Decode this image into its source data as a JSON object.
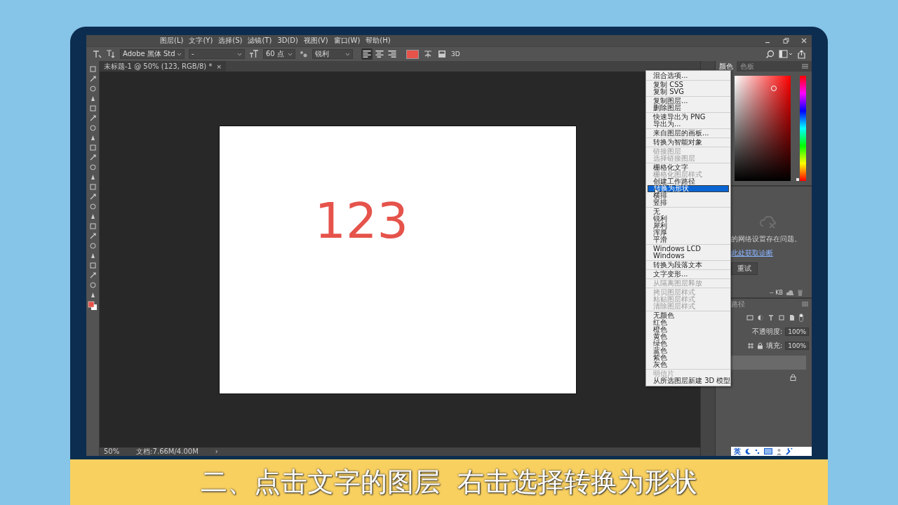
{
  "menu_bar": {
    "items": [
      "图层(L)",
      "文字(Y)",
      "选择(S)",
      "滤镜(T)",
      "3D(D)",
      "视图(V)",
      "窗口(W)",
      "帮助(H)"
    ]
  },
  "options_bar": {
    "font_family": "Adobe 黑体 Std",
    "font_style": "-",
    "size": "60 点",
    "antialias": "锐利",
    "mode_3d": "3D",
    "alignment": [
      {
        "kind": "left",
        "selected": true
      },
      {
        "kind": "center",
        "selected": false
      },
      {
        "kind": "right",
        "selected": false
      }
    ]
  },
  "document_tab": {
    "title": "未标题-1 @ 50% (123, RGB/8) *",
    "close": "×"
  },
  "canvas": {
    "text": "123"
  },
  "status_bar": {
    "zoom": "50%",
    "doc_size": "文档:7.66M/4.00M",
    "arrow": "›"
  },
  "color_panel": {
    "tabs": [
      {
        "label": "颜色",
        "selected": true
      },
      {
        "label": "色板",
        "selected": false
      }
    ],
    "hue_slider": {
      "level": 0
    }
  },
  "libraries_panel": {
    "message": "的网络设置存在问题。",
    "link": "此处获取诊断",
    "retry": "重试",
    "size": "-- KB"
  },
  "layers_panel": {
    "tab": "路径",
    "opacity_label": "不透明度:",
    "opacity": "100%",
    "fill_label": "填充:",
    "fill": "100%"
  },
  "ime_bar": {
    "language": "英"
  },
  "context_menu": {
    "groups": [
      {
        "items": [
          {
            "label": "混合选项...",
            "disabled": false,
            "selected": false
          }
        ]
      },
      {
        "items": [
          {
            "label": "复制 CSS",
            "disabled": false,
            "selected": false
          },
          {
            "label": "复制 SVG",
            "disabled": false,
            "selected": false
          }
        ]
      },
      {
        "items": [
          {
            "label": "复制图层...",
            "disabled": false,
            "selected": false
          },
          {
            "label": "删除图层",
            "disabled": false,
            "selected": false
          }
        ]
      },
      {
        "items": [
          {
            "label": "快速导出为 PNG",
            "disabled": false,
            "selected": false
          },
          {
            "label": "导出为...",
            "disabled": false,
            "selected": false
          }
        ]
      },
      {
        "items": [
          {
            "label": "来自图层的画板...",
            "disabled": false,
            "selected": false
          }
        ]
      },
      {
        "items": [
          {
            "label": "转换为智能对象",
            "disabled": false,
            "selected": false
          }
        ]
      },
      {
        "items": [
          {
            "label": "链接图层",
            "disabled": true,
            "selected": false
          },
          {
            "label": "选择链接图层",
            "disabled": true,
            "selected": false
          }
        ]
      },
      {
        "items": [
          {
            "label": "栅格化文字",
            "disabled": false,
            "selected": false
          },
          {
            "label": "栅格化图层样式",
            "disabled": true,
            "selected": false
          },
          {
            "label": "创建工作路径",
            "disabled": false,
            "selected": false
          },
          {
            "label": "转换为形状",
            "disabled": false,
            "selected": true
          },
          {
            "label": "横排",
            "disabled": false,
            "selected": false
          },
          {
            "label": "竖排",
            "disabled": false,
            "selected": false
          }
        ]
      },
      {
        "items": [
          {
            "label": "无",
            "disabled": false,
            "selected": false
          },
          {
            "label": "锐利",
            "disabled": false,
            "selected": false
          },
          {
            "label": "犀利",
            "disabled": false,
            "selected": false
          },
          {
            "label": "浑厚",
            "disabled": false,
            "selected": false
          },
          {
            "label": "平滑",
            "disabled": false,
            "selected": false
          }
        ]
      },
      {
        "items": [
          {
            "label": "Windows LCD",
            "disabled": false,
            "selected": false
          },
          {
            "label": "Windows",
            "disabled": false,
            "selected": false
          }
        ]
      },
      {
        "items": [
          {
            "label": "转换为段落文本",
            "disabled": false,
            "selected": false
          }
        ]
      },
      {
        "items": [
          {
            "label": "文字变形...",
            "disabled": false,
            "selected": false
          }
        ]
      },
      {
        "items": [
          {
            "label": "从隔离图层释放",
            "disabled": true,
            "selected": false
          }
        ]
      },
      {
        "items": [
          {
            "label": "拷贝图层样式",
            "disabled": true,
            "selected": false
          },
          {
            "label": "粘贴图层样式",
            "disabled": true,
            "selected": false
          },
          {
            "label": "清除图层样式",
            "disabled": true,
            "selected": false
          }
        ]
      },
      {
        "items": [
          {
            "label": "无颜色",
            "disabled": false,
            "selected": false
          },
          {
            "label": "红色",
            "disabled": false,
            "selected": false
          },
          {
            "label": "橙色",
            "disabled": false,
            "selected": false
          },
          {
            "label": "黄色",
            "disabled": false,
            "selected": false
          },
          {
            "label": "绿色",
            "disabled": false,
            "selected": false
          },
          {
            "label": "蓝色",
            "disabled": false,
            "selected": false
          },
          {
            "label": "紫色",
            "disabled": false,
            "selected": false
          },
          {
            "label": "灰色",
            "disabled": false,
            "selected": false
          }
        ]
      },
      {
        "items": [
          {
            "label": "明信片",
            "disabled": true,
            "selected": false
          },
          {
            "label": "从所选图层新建 3D 模型",
            "disabled": false,
            "selected": false
          }
        ]
      }
    ]
  },
  "caption": "二、点击文字的图层  右击选择转换为形状"
}
